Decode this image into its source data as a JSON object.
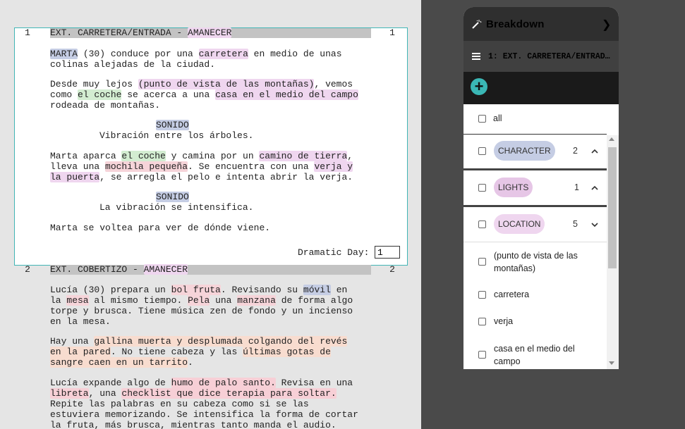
{
  "script": {
    "scene1": {
      "number": "1",
      "heading": [
        "EXT. CARRETERA/ENTRADA - ",
        "AMANECER"
      ],
      "action1": [
        [
          "MARTA",
          " (30) conduce por una ",
          "carretera",
          " en medio de unas"
        ],
        [
          "colinas alejadas de la ciudad."
        ]
      ],
      "action2": [
        [
          "Desde muy lejos ",
          "(punto de vista de las montañas)",
          ", vemos"
        ],
        [
          "como ",
          "el coche",
          " se acerca a una ",
          "casa en el medio del campo"
        ],
        [
          "rodeada de montañas."
        ]
      ],
      "sound1": "SONIDO",
      "sound1_text": "Vibración entre los árboles.",
      "action3": [
        [
          "Marta aparca ",
          "el coche",
          " y camina por un ",
          "camino de tierra",
          ","
        ],
        [
          "lleva una ",
          "mochila pequeña",
          ". Se encuentra con una ",
          "verja y"
        ],
        [
          "la puerta",
          ", se arregla el pelo e intenta abrir la verja."
        ]
      ],
      "sound2": "SONIDO",
      "sound2_text": "La vibración se intensifica.",
      "action4": "Marta se voltea para ver de dónde viene.",
      "dramatic_day_label": "Dramatic Day:",
      "dramatic_day_value": "1"
    },
    "scene2": {
      "number": "2",
      "heading": [
        "EXT. COBERTIZO - ",
        "AMANECER"
      ],
      "p1": [
        [
          "Lucía (30) prepara un ",
          "bol fruta",
          ". Revisando su ",
          "móvil",
          " en"
        ],
        [
          "la ",
          "mesa",
          " al mismo tiempo. ",
          "Pela",
          " una ",
          "manzana",
          " de forma algo"
        ],
        [
          "torpe y brusca. Tiene música zen de fondo y un incienso"
        ],
        [
          "en la mesa."
        ]
      ],
      "p2": [
        [
          "Hay una ",
          "gallina muerta y desplumada colgando del revés"
        ],
        [
          "en la pared",
          ". No tiene cabeza y las ",
          "últimas gotas de"
        ],
        [
          "sangre caen en un tarrito",
          "."
        ]
      ],
      "p3": [
        [
          "Lucía expande algo de ",
          "humo de palo santo.",
          " Revisa en una"
        ],
        [
          "libreta",
          ", una ",
          "checklist que dice terapia para soltar."
        ],
        [
          "Repite las palabras en su cabeza como si se las"
        ],
        [
          "estuviera memorizando. Se intensifica la forma de cortar"
        ],
        [
          "la fruta, más brusca, mientras tanto manda el audio."
        ]
      ]
    }
  },
  "panel": {
    "title": "Breakdown",
    "scene_title": "1: EXT. CARRETERA/ENTRADA...",
    "add_label": "+",
    "all_label": "all",
    "categories": [
      {
        "label": "CHARACTER",
        "count": "2",
        "color": "#c5cde4",
        "state": "expanded"
      },
      {
        "label": "LIGHTS",
        "count": "1",
        "color": "#e6c6e6",
        "state": "expanded"
      },
      {
        "label": "LOCATION",
        "count": "5",
        "color": "#efd6ef",
        "state": "collapsed"
      }
    ],
    "location_items": [
      [
        "(punto de vista de las",
        "montañas)"
      ],
      [
        "carretera"
      ],
      [
        "verja"
      ],
      [
        "casa en el medio del",
        "campo"
      ]
    ]
  },
  "icons": {
    "header": "wand-icon",
    "expand": "chevron-right-icon",
    "menu": "hamburger-icon"
  }
}
